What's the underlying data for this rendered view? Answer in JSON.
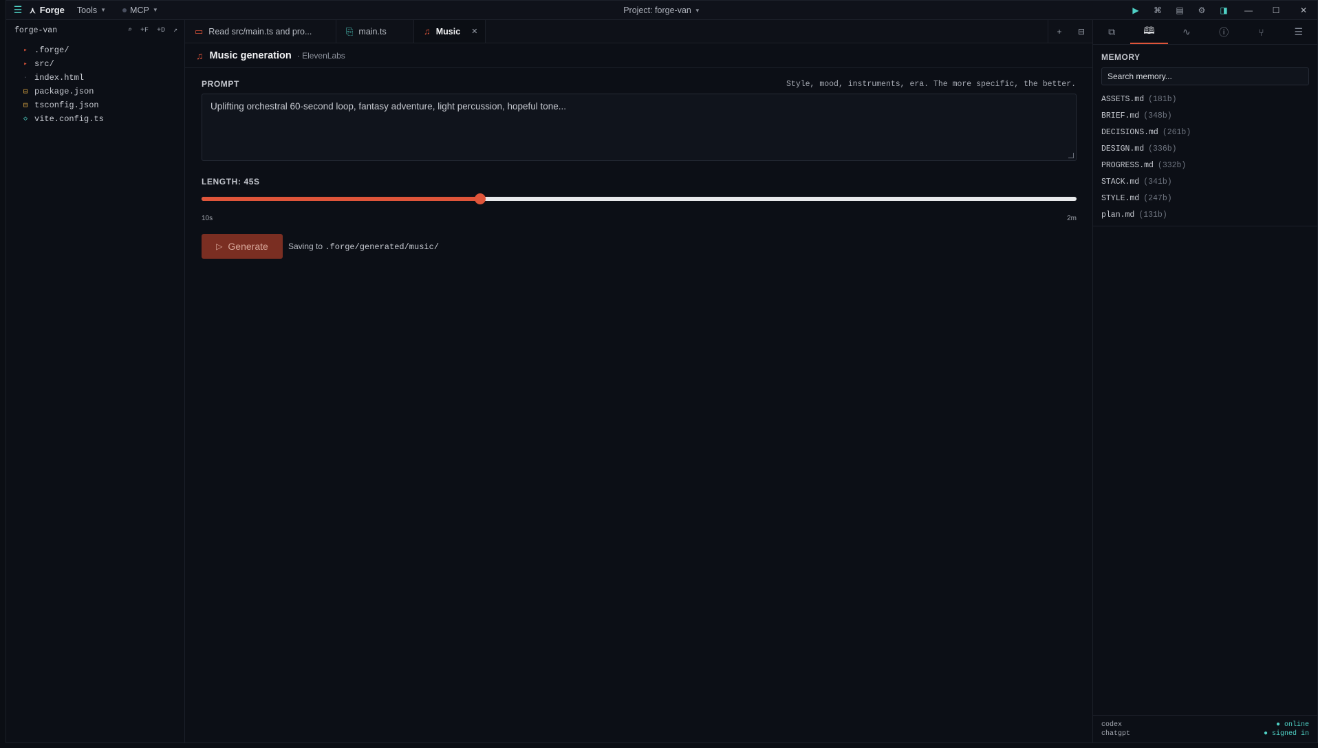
{
  "titlebar": {
    "app_name": "Forge",
    "menus": [
      {
        "label": "Tools"
      },
      {
        "label": "MCP"
      }
    ],
    "project_title": "Project: forge-van"
  },
  "sidebar": {
    "title": "forge-van",
    "actions": [
      "⌕",
      "+F",
      "+D",
      "↗"
    ],
    "items": [
      {
        "label": ".forge/",
        "icon": "folder-icon"
      },
      {
        "label": "src/",
        "icon": "folder-icon"
      },
      {
        "label": "index.html",
        "icon": "html-file-icon"
      },
      {
        "label": "package.json",
        "icon": "json-file-icon"
      },
      {
        "label": "tsconfig.json",
        "icon": "json-file-icon"
      },
      {
        "label": "vite.config.ts",
        "icon": "ts-file-icon"
      }
    ]
  },
  "tabs": [
    {
      "label": "Read src/main.ts and pro..."
    },
    {
      "label": "main.ts"
    },
    {
      "label": "Music",
      "active": true
    }
  ],
  "page": {
    "title": "Music generation",
    "subtitle": "· ElevenLabs",
    "prompt_label": "PROMPT",
    "prompt_hint": "Style, mood, instruments, era. The more specific, the better.",
    "prompt_value": "Uplifting orchestral 60-second loop, fantasy adventure, light percussion, hopeful tone...",
    "length_label": "LENGTH: 45S",
    "length_min_label": "10s",
    "length_max_label": "2m",
    "length_seconds": 45,
    "length_min_seconds": 10,
    "length_max_seconds": 120,
    "generate_label": "Generate",
    "saving_prefix": "Saving to",
    "saving_path": ".forge/generated/music/"
  },
  "rpanel": {
    "section_title": "MEMORY",
    "search_placeholder": "Search memory...",
    "items": [
      {
        "name": "ASSETS.md",
        "size": "(181b)"
      },
      {
        "name": "BRIEF.md",
        "size": "(348b)"
      },
      {
        "name": "DECISIONS.md",
        "size": "(261b)"
      },
      {
        "name": "DESIGN.md",
        "size": "(336b)"
      },
      {
        "name": "PROGRESS.md",
        "size": "(332b)"
      },
      {
        "name": "STACK.md",
        "size": "(341b)"
      },
      {
        "name": "STYLE.md",
        "size": "(247b)"
      },
      {
        "name": "plan.md",
        "size": "(131b)"
      }
    ],
    "footer": [
      {
        "name": "codex",
        "status": "● online"
      },
      {
        "name": "chatgpt",
        "status": "● signed in"
      }
    ]
  },
  "colors": {
    "accent": "#e0553a",
    "teal": "#4fd1c5",
    "background": "#0b0e14"
  }
}
